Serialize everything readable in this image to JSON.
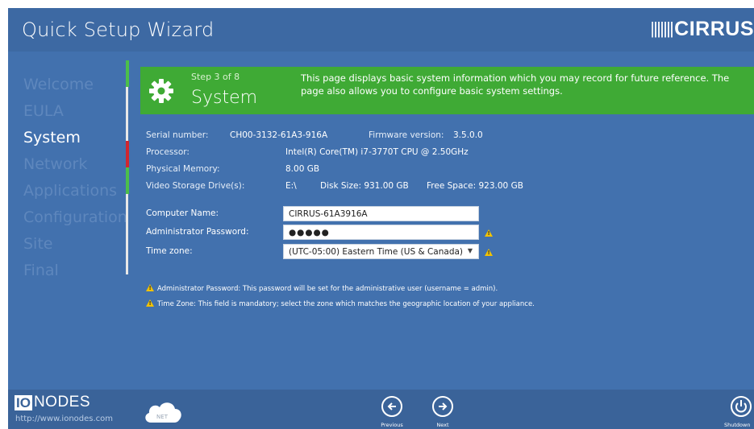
{
  "header": {
    "title": "Quick Setup Wizard",
    "brand": "CIRRUS"
  },
  "sidebar": {
    "items": [
      {
        "label": "Welcome"
      },
      {
        "label": "EULA"
      },
      {
        "label": "System"
      },
      {
        "label": "Network"
      },
      {
        "label": "Applications"
      },
      {
        "label": "Configuration"
      },
      {
        "label": "Site"
      },
      {
        "label": "Final"
      }
    ],
    "active_index": 2
  },
  "banner": {
    "step": "Step 3 of 8",
    "title": "System",
    "description": "This page displays basic system information which you may record for future reference.  The page also allows you to configure basic system settings.",
    "icon": "gear-icon"
  },
  "system_info": {
    "serial_label": "Serial number:",
    "serial_value": "CH00-3132-61A3-916A",
    "firmware_label": "Firmware version:",
    "firmware_value": "3.5.0.0",
    "processor_label": "Processor:",
    "processor_value": "Intel(R) Core(TM) i7-3770T CPU @ 2.50GHz",
    "memory_label": "Physical Memory:",
    "memory_value": "8.00 GB",
    "storage_label": "Video Storage Drive(s):",
    "storage_drive": "E:\\",
    "disk_size": "Disk Size:  931.00 GB",
    "free_space": "Free Space:  923.00 GB"
  },
  "form": {
    "computer_name_label": "Computer Name:",
    "computer_name_value": "CIRRUS-61A3916A",
    "admin_password_label": "Administrator Password:",
    "admin_password_value": "●●●●●",
    "timezone_label": "Time zone:",
    "timezone_value": "(UTC-05:00) Eastern Time (US & Canada)"
  },
  "notes": {
    "password_note": "Administrator Password:  This password will be set for the administrative user (username = admin).",
    "timezone_note": "Time Zone:  This field is mandatory; select the zone which matches the geographic location of your appliance."
  },
  "footer": {
    "logo_io": "IO",
    "logo_nodes": "NODES",
    "url": "http://www.ionodes.com",
    "cloud_label": "NET",
    "previous_label": "Previous",
    "next_label": "Next",
    "shutdown_label": "Shutdown"
  },
  "colors": {
    "background": "#4271ae",
    "banner": "#3faa35",
    "warning": "#f2c200",
    "step_marker_red": "#d0262f",
    "step_marker_green": "#4cbf4a"
  }
}
